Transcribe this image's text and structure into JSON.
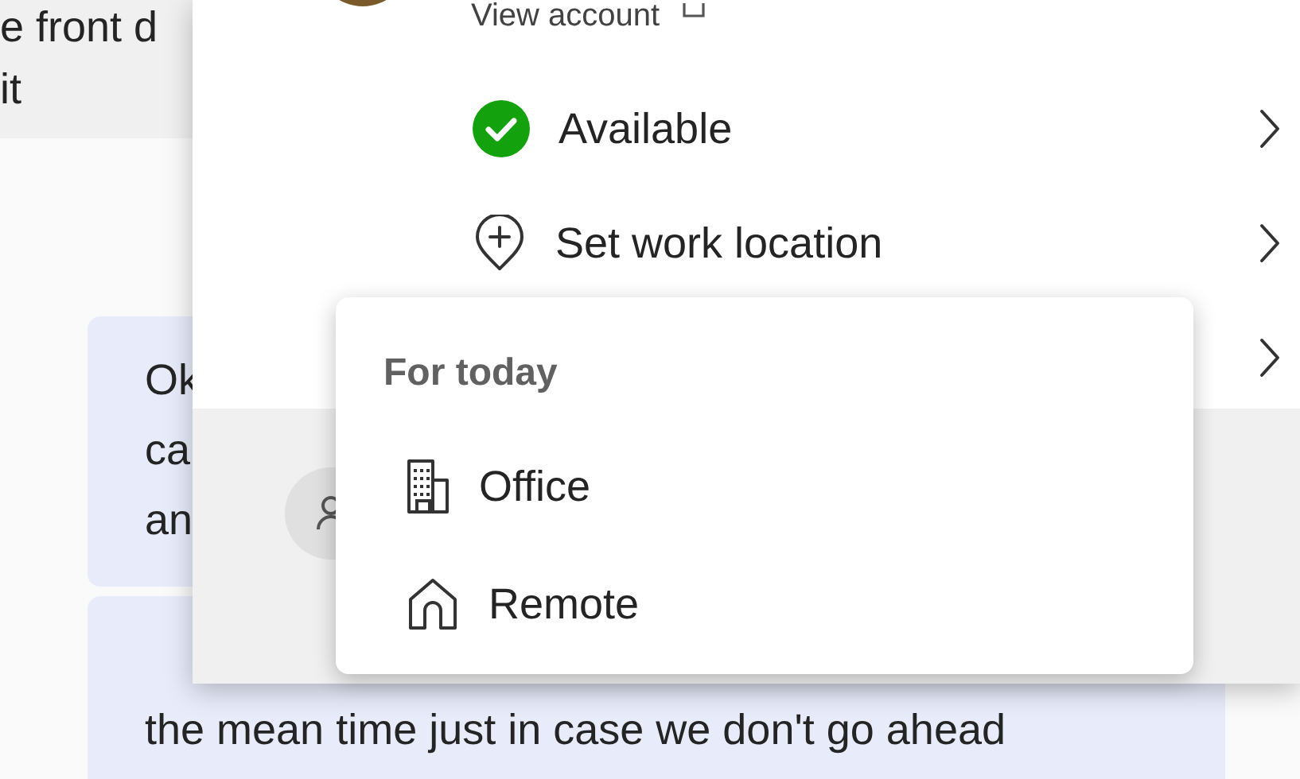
{
  "chat": {
    "messages": [
      {
        "kind": "received",
        "lines": [
          "e front d",
          "it"
        ]
      },
      {
        "kind": "sent",
        "lines": [
          "Ok",
          "ca",
          "an"
        ]
      },
      {
        "kind": "sent",
        "lines": [
          "the mean time just in case we don't go ahead"
        ]
      }
    ]
  },
  "account_menu": {
    "view_account": "View account",
    "items": [
      {
        "kind": "status",
        "label": "Available"
      },
      {
        "kind": "location",
        "label": "Set work location"
      },
      {
        "kind": "covered"
      }
    ]
  },
  "location_submenu": {
    "heading": "For today",
    "options": [
      {
        "kind": "office",
        "label": "Office"
      },
      {
        "kind": "remote",
        "label": "Remote"
      }
    ]
  }
}
